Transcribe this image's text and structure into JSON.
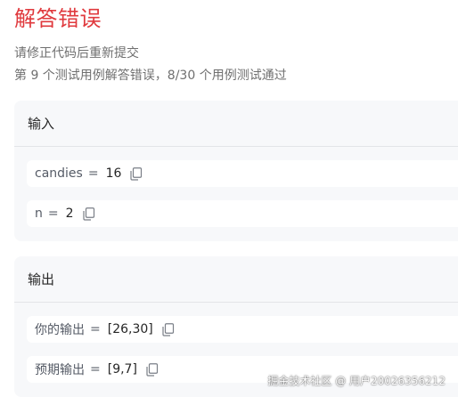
{
  "header": {
    "title": "解答错误",
    "hint": "请修正代码后重新提交",
    "summary": "第 9 个测试用例解答错误，8/30 个用例测试通过"
  },
  "input_panel": {
    "label": "输入",
    "params": [
      {
        "name": "candies",
        "eq": "=",
        "value": "16",
        "icon": "copy-icon"
      },
      {
        "name": "n",
        "eq": "=",
        "value": "2",
        "icon": "copy-icon"
      }
    ]
  },
  "output_panel": {
    "label": "输出",
    "rows": [
      {
        "name": "你的输出",
        "eq": "=",
        "value": "[26,30]",
        "icon": "copy-icon"
      },
      {
        "name": "预期输出",
        "eq": "=",
        "value": "[9,7]",
        "icon": "copy-icon"
      }
    ]
  },
  "watermark": "掘金技术社区 @ 用户20026356212",
  "colors": {
    "error": "#e03a3e",
    "panel_bg": "#f7f8fa",
    "row_bg": "#ffffff"
  }
}
